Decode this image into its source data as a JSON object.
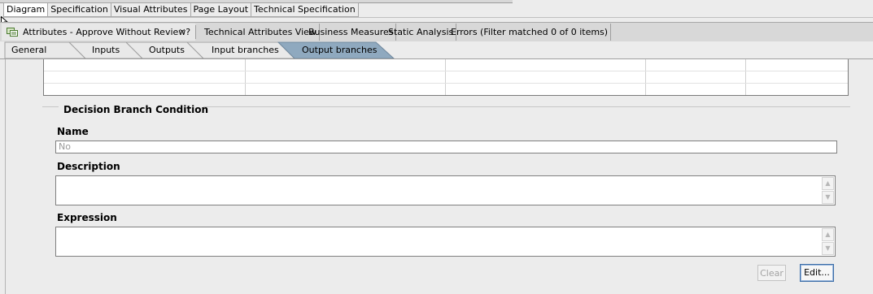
{
  "top_tabs": [
    "Diagram",
    "Specification",
    "Visual Attributes",
    "Page Layout",
    "Technical Specification"
  ],
  "view_tabs": {
    "active_label": "Attributes - Approve Without Review?",
    "close_glyph": "✕",
    "others": [
      "Technical Attributes View",
      "Business Measures",
      "Static Analysis",
      "Errors (Filter matched 0 of 0 items)"
    ]
  },
  "section_tabs": [
    "General",
    "Inputs",
    "Outputs",
    "Input branches",
    "Output branches"
  ],
  "section_active": "Output branches",
  "group": {
    "title": "Decision Branch Condition"
  },
  "fields": {
    "name_label": "Name",
    "name_value": "No",
    "description_label": "Description",
    "expression_label": "Expression"
  },
  "buttons": {
    "clear": "Clear",
    "edit": "Edit..."
  },
  "icons": {
    "attributes": "attributes-icon",
    "scroll_up": "▲",
    "scroll_down": "▼"
  }
}
